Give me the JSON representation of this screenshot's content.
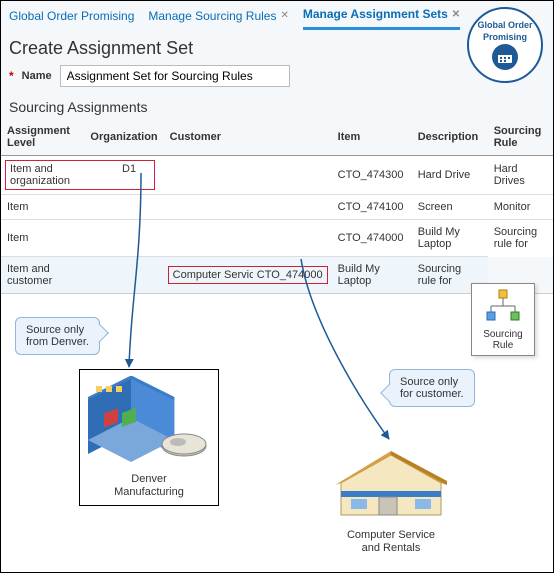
{
  "badge": {
    "line1": "Global Order",
    "line2": "Promising",
    "icon": "calendar"
  },
  "tabs": {
    "t0": {
      "label": "Global Order Promising"
    },
    "t1": {
      "label": "Manage Sourcing Rules"
    },
    "t2": {
      "label": "Manage Assignment Sets"
    }
  },
  "page": {
    "title": "Create Assignment Set"
  },
  "form": {
    "required_mark": "*",
    "name_label": "Name",
    "name_value": "Assignment Set for Sourcing Rules"
  },
  "section": {
    "title": "Sourcing Assignments"
  },
  "columns": {
    "c0": "Assignment Level",
    "c1": "Organization",
    "c2": "Customer",
    "c3": "Item",
    "c4": "Description",
    "c5": "Sourcing Rule"
  },
  "rows": {
    "r0": {
      "level": "Item and organization",
      "org": "D1",
      "cust": "",
      "item": "CTO_474300",
      "desc": "Hard Drive",
      "rule": "Hard Drives"
    },
    "r1": {
      "level": "Item",
      "org": "",
      "cust": "",
      "item": "CTO_474100",
      "desc": "Screen",
      "rule": "Monitor"
    },
    "r2": {
      "level": "Item",
      "org": "",
      "cust": "",
      "item": "CTO_474000",
      "desc": "Build My Laptop",
      "rule": "Sourcing rule for"
    },
    "r3": {
      "level": "Item and customer",
      "org": "",
      "cust": "Computer Servic",
      "item": "CTO_474000",
      "desc": "Build My Laptop",
      "rule": "Sourcing rule for"
    }
  },
  "callouts": {
    "denver": {
      "l1": "Source only",
      "l2": "from Denver."
    },
    "customer": {
      "l1": "Source only",
      "l2": "for customer."
    }
  },
  "objects": {
    "denver_factory": {
      "l1": "Denver",
      "l2": "Manufacturing"
    },
    "customer_factory": {
      "l1": "Computer Service",
      "l2": "and Rentals"
    },
    "sourcing_rule": {
      "l1": "Sourcing",
      "l2": "Rule"
    }
  }
}
